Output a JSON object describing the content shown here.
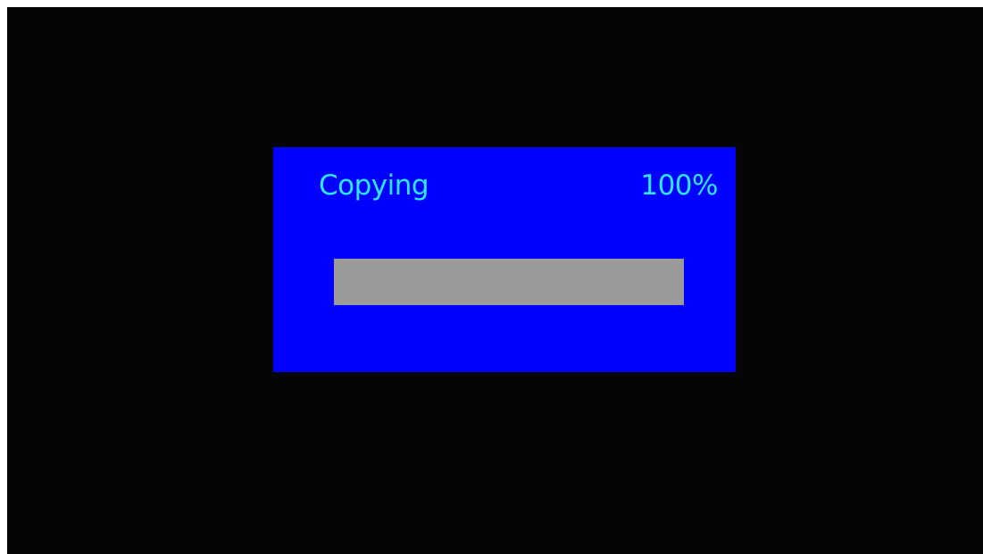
{
  "dialog": {
    "title": "Copying",
    "percent_label": "100%",
    "progress_fraction": 1.0
  },
  "colors": {
    "background": "#050505",
    "dialog_background": "#0000ff",
    "text": "#2ee6f5",
    "progress_fill": "#9a9a9a"
  }
}
